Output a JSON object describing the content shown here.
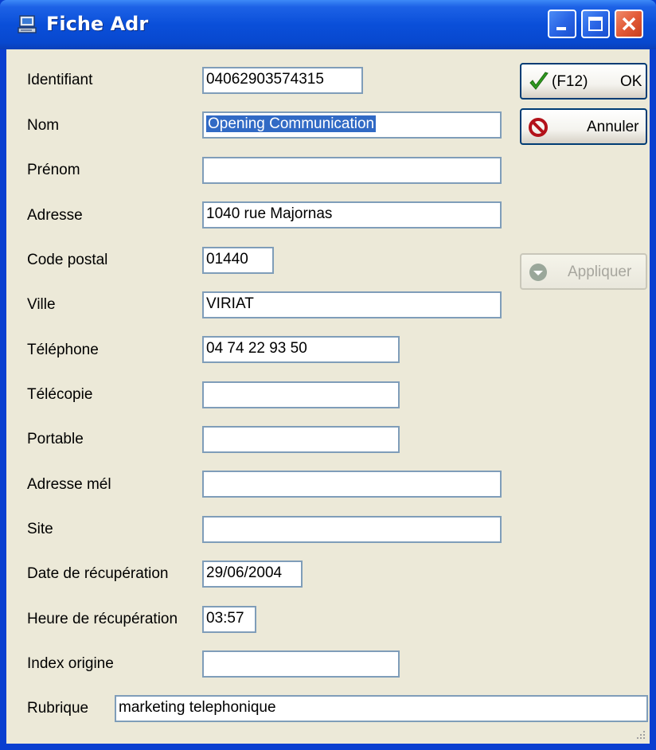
{
  "window": {
    "title": "Fiche Adr"
  },
  "buttons": {
    "ok_shortcut": "(F12)",
    "ok_label": "OK",
    "cancel_label": "Annuler",
    "apply_label": "Appliquer"
  },
  "fields": {
    "identifiant": {
      "label": "Identifiant",
      "value": "04062903574315"
    },
    "nom": {
      "label": "Nom",
      "value": "Opening Communication"
    },
    "prenom": {
      "label": "Prénom",
      "value": ""
    },
    "adresse": {
      "label": "Adresse",
      "value": "1040 rue Majornas"
    },
    "code_postal": {
      "label": "Code postal",
      "value": "01440"
    },
    "ville": {
      "label": "Ville",
      "value": "VIRIAT"
    },
    "telephone": {
      "label": "Téléphone",
      "value": "04 74 22 93 50"
    },
    "telecopie": {
      "label": "Télécopie",
      "value": ""
    },
    "portable": {
      "label": "Portable",
      "value": ""
    },
    "adresse_mel": {
      "label": "Adresse mél",
      "value": ""
    },
    "site": {
      "label": "Site",
      "value": ""
    },
    "date_recuperation": {
      "label": "Date de récupération",
      "value": "29/06/2004"
    },
    "heure_recuperation": {
      "label": "Heure de récupération",
      "value": "03:57"
    },
    "index_origine": {
      "label": "Index origine",
      "value": ""
    },
    "rubrique": {
      "label": "Rubrique",
      "value": "marketing telephonique"
    }
  },
  "icons": {
    "title": "app-window-icon",
    "ok": "checkmark-icon",
    "cancel": "no-entry-icon",
    "apply": "apply-arrow-icon"
  },
  "colors": {
    "titlebar": "#0a4fd9",
    "client_bg": "#ece9d8",
    "field_border": "#7f9db9",
    "selection": "#316ac5",
    "close_button": "#e25a37"
  }
}
